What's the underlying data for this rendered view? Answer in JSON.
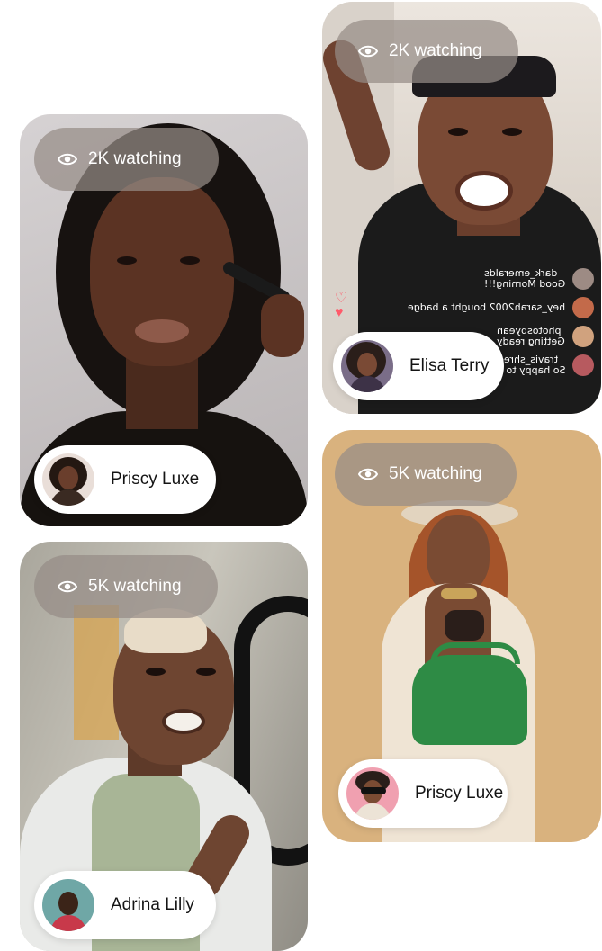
{
  "streams": [
    {
      "watching": "2K watching",
      "host": "Priscy Luxe",
      "colors": {
        "wall": "#c9c4c6",
        "skin": "#5b3323",
        "hair": "#171210",
        "top": "#16120f"
      }
    },
    {
      "watching": "2K watching",
      "host": "Elisa Terry",
      "colors": {
        "wall": "#d7d0c8",
        "skin": "#7a4a35",
        "hair": "#1c1a1d",
        "top": "#1b1b1b"
      },
      "chat": [
        {
          "text": "dark_emeralds\nGood Morning!!!"
        },
        {
          "text": "hey_sarah2002 bought a badge"
        },
        {
          "text": "photosbyean\nGetting ready"
        },
        {
          "text": "travis_shred\nSo happy to c"
        }
      ]
    },
    {
      "watching": "5K watching",
      "host": "Priscy Luxe",
      "colors": {
        "wall": "#d9b27e",
        "skin": "#7a4b33",
        "hair": "#a5542a",
        "top": "#efe4d4",
        "bag": "#2e8b45"
      }
    },
    {
      "watching": "5K watching",
      "host": "Adrina Lilly",
      "colors": {
        "wall": "#b9b6ad",
        "skin": "#6e4531",
        "hair": "#e8dcc8",
        "top": "#e9eae8"
      }
    }
  ],
  "icons": {
    "views": "eye-icon"
  }
}
